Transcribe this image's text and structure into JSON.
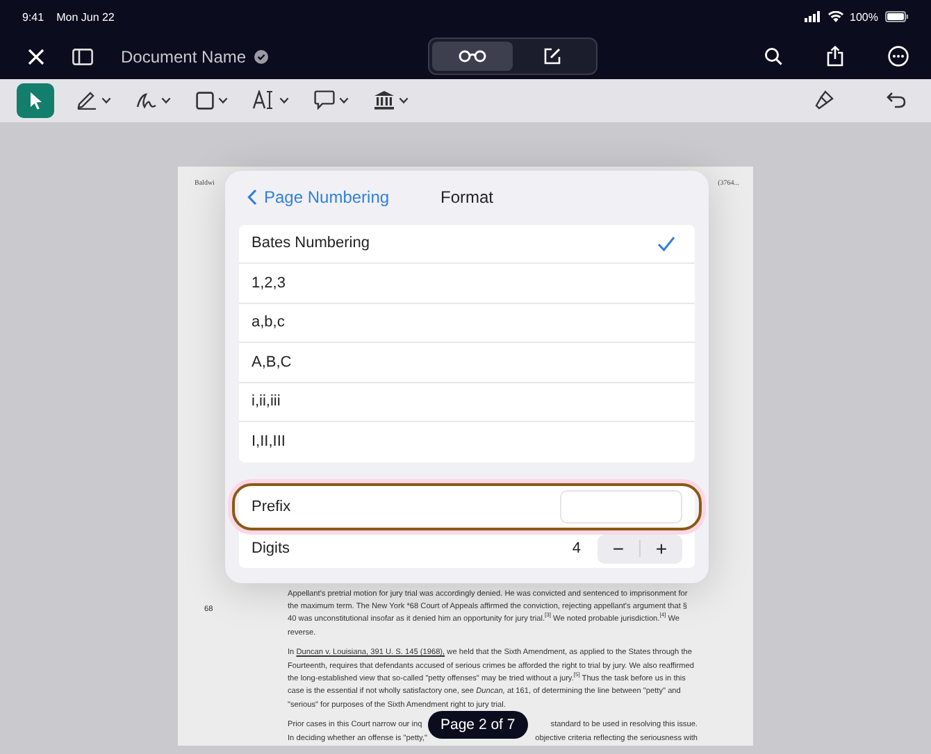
{
  "status_bar": {
    "time": "9:41",
    "date": "Mon Jun 22",
    "battery": "100%"
  },
  "nav_bar": {
    "title": "Document Name",
    "verified": true,
    "modes": [
      {
        "kind": "read",
        "selected": true
      },
      {
        "kind": "edit",
        "selected": false
      }
    ]
  },
  "toolbar": {
    "tools": [
      {
        "kind": "select",
        "selected": true,
        "menu": false
      },
      {
        "kind": "pen",
        "selected": false,
        "menu": true
      },
      {
        "kind": "signature",
        "selected": false,
        "menu": true
      },
      {
        "kind": "shape",
        "selected": false,
        "menu": true
      },
      {
        "kind": "text",
        "selected": false,
        "menu": true
      },
      {
        "kind": "comment",
        "selected": false,
        "menu": true
      },
      {
        "kind": "stamp",
        "selected": false,
        "menu": true
      }
    ]
  },
  "document": {
    "header_left": "Baldwi",
    "header_right": "(3764...",
    "line_number": "68",
    "paragraph_1": "Appellant's pretrial motion for jury trial was accordingly denied. He was convicted and sentenced to imprisonment for the maximum term. The New York *68 Court of Appeals affirmed the conviction, rejecting appellant's argument that § 40 was unconstitutional insofar as it denied him an opportunity for jury trial.$^{[3]}$ We noted probable jurisdiction.$^{[4]}$ We reverse.",
    "paragraph_2": {
      "before": "In",
      "link": "Duncan v. Louisiana, 391 U. S. 145 (1968),",
      "after": "we held that the Sixth Amendment, as applied to the States through the Fourteenth, requires that defendants accused of serious crimes be afforded the right to trial by jury. We also reaffirmed the long-established view that so-called \"petty offenses\" may be tried without a jury.$^{[5]}$ Thus the task before us in this case is the essential if not wholly satisfactory one, see *Duncan,* at 161, of determining the line between \"petty\" and \"serious\" for purposes of the Sixth Amendment right to jury trial."
    },
    "paragraph_3_lines": [
      {
        "left": "Prior cases in this Court narrow our inq",
        "right": "standard to be used in resolving this issue."
      },
      {
        "left": "In deciding whether an offense is \"petty,\"",
        "right": "objective criteria reflecting the seriousness with"
      }
    ]
  },
  "popover": {
    "back": "Page Numbering",
    "title": "Format",
    "options": [
      {
        "label": "Bates Numbering",
        "selected": true
      },
      {
        "label": "1,2,3",
        "selected": false
      },
      {
        "label": "a,b,c",
        "selected": false
      },
      {
        "label": "A,B,C",
        "selected": false
      },
      {
        "label": "i,ii,iii",
        "selected": false
      },
      {
        "label": "I,II,III",
        "selected": false
      }
    ],
    "prefix": {
      "label": "Prefix",
      "highlighted": true
    },
    "digits": {
      "label": "Digits",
      "value": "4",
      "minus": "−",
      "plus": "+"
    }
  },
  "page_indicator": "Page 2 of 7"
}
